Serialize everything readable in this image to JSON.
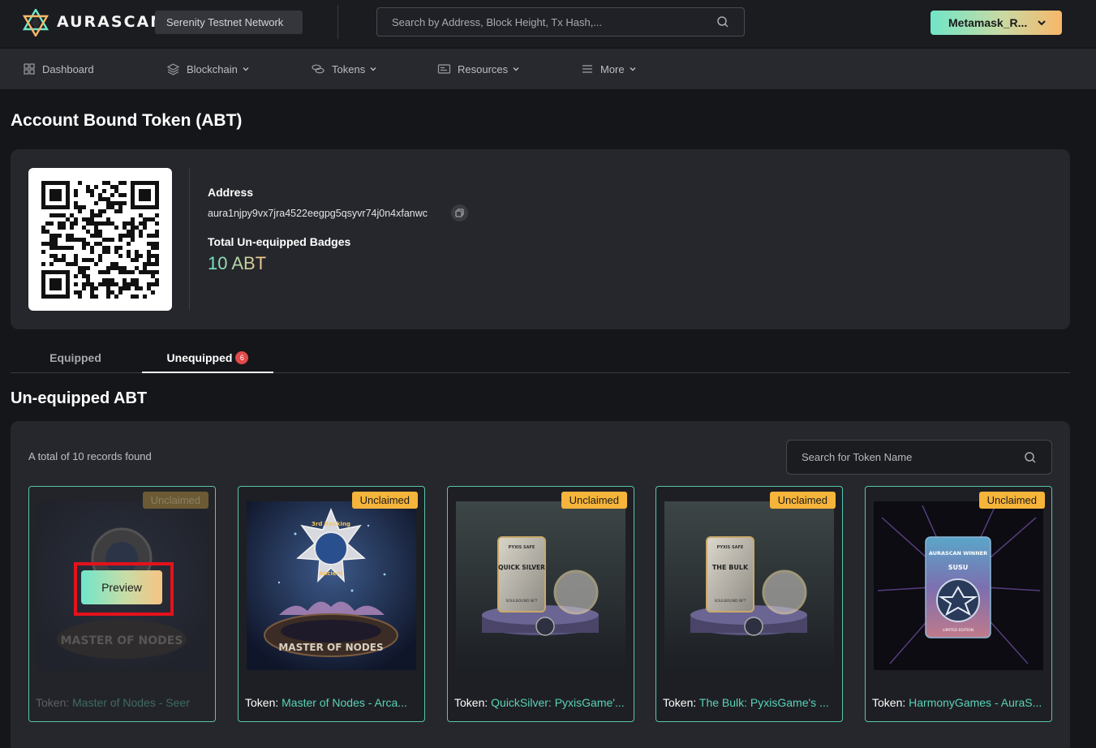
{
  "header": {
    "brand": "AURASCAN",
    "network": "Serenity Testnet Network",
    "search_placeholder": "Search by Address, Block Height, Tx Hash,...",
    "wallet_label": "Metamask_R..."
  },
  "nav": {
    "items": [
      {
        "label": "Dashboard",
        "icon": "grid-icon"
      },
      {
        "label": "Blockchain",
        "icon": "layers-icon"
      },
      {
        "label": "Tokens",
        "icon": "coins-icon"
      },
      {
        "label": "Resources",
        "icon": "window-icon"
      },
      {
        "label": "More",
        "icon": "menu-icon"
      }
    ]
  },
  "page_title": "Account Bound Token (ABT)",
  "account": {
    "address_label": "Address",
    "address": "aura1njpy9vx7jra4522eegpg5qsyvr74j0n4xfanwc",
    "badges_label": "Total Un-equipped Badges",
    "badges_value": "10 ABT"
  },
  "tabs": {
    "equipped": "Equipped",
    "unequipped": "Unequipped",
    "unequipped_count": "6"
  },
  "section_title": "Un-equipped ABT",
  "records": {
    "count_text": "A total of 10 records found",
    "search_placeholder": "Search for Token Name",
    "token_prefix": "Token:",
    "preview_label": "Preview",
    "items": [
      {
        "tag": "Unclaimed",
        "name": "Master of Nodes - Seer"
      },
      {
        "tag": "Unclaimed",
        "name": "Master of Nodes - Arca..."
      },
      {
        "tag": "Unclaimed",
        "name": "QuickSilver: PyxisGame'..."
      },
      {
        "tag": "Unclaimed",
        "name": "The Bulk: PyxisGame's ..."
      },
      {
        "tag": "Unclaimed",
        "name": "HarmonyGames - AuraS..."
      }
    ],
    "art_text": {
      "trophy_top": "3rd Ranking",
      "trophy_mid": "Ancient",
      "trophy_base": "MASTER OF NODES",
      "card1_header": "PYXIS SAFE",
      "card1_title": "QUICK SILVER",
      "card2_header": "PYXIS SAFE",
      "card2_title": "THE BULK",
      "card_footer": "SOULBOUND NFT",
      "winner_title": "AURASCAN WINNER",
      "winner_name": "SUSU",
      "winner_footer": "LIMITED EDITION"
    }
  }
}
